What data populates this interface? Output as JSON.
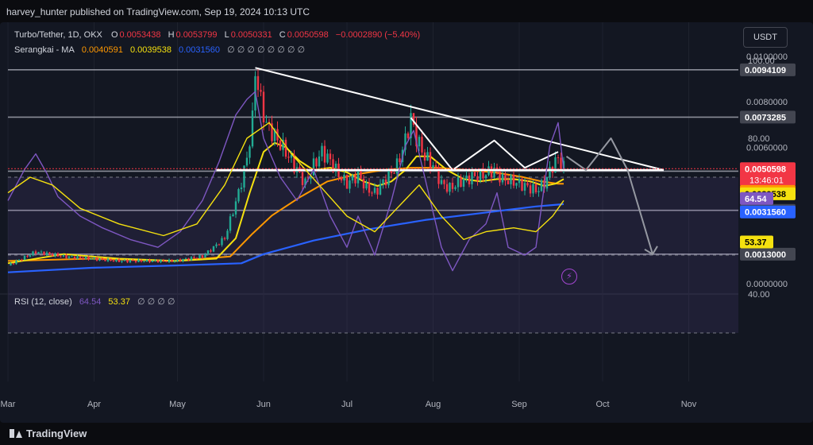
{
  "header": {
    "title": "harvey_hunter published on TradingView.com, Sep 19, 2024 10:13 UTC"
  },
  "footer": {
    "logo_text": "TradingView"
  },
  "toolbar": {
    "currency_label": "USDT"
  },
  "legend": {
    "symbol": "Turbo/Tether, 1D, OKX",
    "o_label": "O",
    "o_value": "0.0053438",
    "h_label": "H",
    "h_value": "0.0053799",
    "l_label": "L",
    "l_value": "0.0050331",
    "c_label": "C",
    "c_value": "0.0050598",
    "change": "−0.0002890 (−5.40%)",
    "ma_name": "Serangkai - MA",
    "ma_values": [
      "0.0040591",
      "0.0039538",
      "0.0031560"
    ],
    "ma_colors": [
      "#ff9800",
      "#f5e10f",
      "#2962ff"
    ],
    "ma_placeholders": "∅ ∅ ∅ ∅ ∅ ∅ ∅ ∅",
    "rsi_name": "RSI (12, close)",
    "rsi_values": [
      "64.54",
      "53.37"
    ],
    "rsi_placeholders": "∅ ∅ ∅ ∅"
  },
  "chart_data": {
    "type": "candlestick",
    "x_ticks": [
      "Mar",
      "Apr",
      "May",
      "Jun",
      "Jul",
      "Aug",
      "Sep",
      "Oct",
      "Nov"
    ],
    "x_tick_pos": [
      0,
      31,
      61,
      92,
      122,
      153,
      184,
      214,
      245
    ],
    "price_axis_labels": [
      "0.0100000",
      "0.0080000",
      "0.0060000",
      "0.0000000"
    ],
    "price_axis_values": [
      0.01,
      0.008,
      0.006,
      0.0
    ],
    "horizontal_levels": [
      {
        "value": 0.0094109,
        "label": "0.0094109",
        "color": "#b2b5be"
      },
      {
        "value": 0.0073285,
        "label": "0.0073285",
        "color": "#b2b5be"
      },
      {
        "value": 0.00495,
        "label": "0.0049500",
        "color": "#b2b5be"
      },
      {
        "value": 0.0032275,
        "label": "0.0032275",
        "color": "#b2b5be"
      },
      {
        "value": 0.0013,
        "label": "0.0013000",
        "color": "#b2b5be"
      }
    ],
    "badges": [
      {
        "value": 0.0050598,
        "label": "0.0050598",
        "sub": "13:46:01",
        "color": "#f23645"
      },
      {
        "value": 0.0040591,
        "label": "0.0040591",
        "color": "#ff9800"
      },
      {
        "value": 0.0039538,
        "label": "0.0039538",
        "color": "#f5e10f"
      },
      {
        "value": 0.003156,
        "label": "0.0031560",
        "color": "#2962ff"
      }
    ],
    "rsi_axis_labels": [
      "100.00",
      "80.00",
      "40.00"
    ],
    "rsi_axis_values": [
      100,
      80,
      40
    ],
    "rsi_badges": [
      {
        "value": 64.54,
        "label": "64.54",
        "color": "#7e57c2"
      },
      {
        "value": 53.37,
        "label": "53.37",
        "color": "#f5e10f"
      }
    ],
    "rsi_bands": [
      70,
      50,
      30
    ],
    "price_path": [
      [
        0,
        0.0008
      ],
      [
        10,
        0.0014
      ],
      [
        20,
        0.0012
      ],
      [
        30,
        0.0011
      ],
      [
        40,
        0.001
      ],
      [
        50,
        0.001
      ],
      [
        60,
        0.001
      ],
      [
        70,
        0.0012
      ],
      [
        78,
        0.002
      ],
      [
        83,
        0.004
      ],
      [
        86,
        0.0055
      ],
      [
        88,
        0.0072
      ],
      [
        89,
        0.0094
      ],
      [
        91,
        0.008
      ],
      [
        93,
        0.007
      ],
      [
        96,
        0.0065
      ],
      [
        100,
        0.0058
      ],
      [
        104,
        0.005
      ],
      [
        107,
        0.0044
      ],
      [
        110,
        0.0052
      ],
      [
        113,
        0.0058
      ],
      [
        116,
        0.0054
      ],
      [
        119,
        0.0048
      ],
      [
        122,
        0.0044
      ],
      [
        126,
        0.0048
      ],
      [
        129,
        0.0042
      ],
      [
        132,
        0.004
      ],
      [
        136,
        0.0046
      ],
      [
        140,
        0.0052
      ],
      [
        143,
        0.0063
      ],
      [
        145,
        0.0073
      ],
      [
        147,
        0.0064
      ],
      [
        150,
        0.0056
      ],
      [
        153,
        0.0052
      ],
      [
        156,
        0.0044
      ],
      [
        159,
        0.0042
      ],
      [
        163,
        0.0045
      ],
      [
        167,
        0.0047
      ],
      [
        171,
        0.0048
      ],
      [
        175,
        0.005
      ],
      [
        178,
        0.0046
      ],
      [
        182,
        0.0045
      ],
      [
        186,
        0.0043
      ],
      [
        190,
        0.0041
      ],
      [
        193,
        0.0044
      ],
      [
        196,
        0.0052
      ],
      [
        198,
        0.0055
      ],
      [
        200,
        0.0051
      ]
    ],
    "ma_fast": [
      [
        0,
        0.0009
      ],
      [
        20,
        0.0013
      ],
      [
        40,
        0.0011
      ],
      [
        60,
        0.001
      ],
      [
        75,
        0.0011
      ],
      [
        82,
        0.002
      ],
      [
        87,
        0.004
      ],
      [
        92,
        0.0058
      ],
      [
        96,
        0.0062
      ],
      [
        100,
        0.006
      ],
      [
        105,
        0.0054
      ],
      [
        110,
        0.005
      ],
      [
        116,
        0.0051
      ],
      [
        122,
        0.0049
      ],
      [
        128,
        0.0045
      ],
      [
        133,
        0.0043
      ],
      [
        138,
        0.0045
      ],
      [
        143,
        0.005
      ],
      [
        147,
        0.0056
      ],
      [
        152,
        0.0056
      ],
      [
        158,
        0.005
      ],
      [
        164,
        0.0046
      ],
      [
        170,
        0.0045
      ],
      [
        176,
        0.0046
      ],
      [
        182,
        0.0046
      ],
      [
        188,
        0.0045
      ],
      [
        193,
        0.0043
      ],
      [
        197,
        0.0044
      ],
      [
        200,
        0.0046
      ]
    ],
    "ma_mid": [
      [
        0,
        0.001
      ],
      [
        30,
        0.0011
      ],
      [
        60,
        0.001
      ],
      [
        80,
        0.0012
      ],
      [
        88,
        0.0022
      ],
      [
        95,
        0.003
      ],
      [
        105,
        0.0038
      ],
      [
        115,
        0.0045
      ],
      [
        125,
        0.0048
      ],
      [
        135,
        0.005
      ],
      [
        145,
        0.0051
      ],
      [
        155,
        0.0051
      ],
      [
        165,
        0.005
      ],
      [
        175,
        0.0049
      ],
      [
        185,
        0.0047
      ],
      [
        192,
        0.0045
      ],
      [
        198,
        0.0044
      ],
      [
        200,
        0.0044
      ]
    ],
    "ma_slow": [
      [
        0,
        0.0005
      ],
      [
        30,
        0.0007
      ],
      [
        60,
        0.0008
      ],
      [
        84,
        0.0009
      ],
      [
        92,
        0.0013
      ],
      [
        110,
        0.0019
      ],
      [
        130,
        0.0024
      ],
      [
        150,
        0.0028
      ],
      [
        170,
        0.0031
      ],
      [
        190,
        0.0034
      ],
      [
        200,
        0.0035
      ]
    ],
    "rsi_main": [
      [
        0,
        64
      ],
      [
        6,
        72
      ],
      [
        10,
        76
      ],
      [
        14,
        71
      ],
      [
        18,
        65
      ],
      [
        26,
        60
      ],
      [
        34,
        57
      ],
      [
        44,
        54
      ],
      [
        54,
        52
      ],
      [
        62,
        56
      ],
      [
        70,
        64
      ],
      [
        76,
        74
      ],
      [
        82,
        86
      ],
      [
        86,
        90
      ],
      [
        89,
        92
      ],
      [
        92,
        80
      ],
      [
        98,
        70
      ],
      [
        104,
        64
      ],
      [
        110,
        72
      ],
      [
        116,
        60
      ],
      [
        122,
        52
      ],
      [
        126,
        60
      ],
      [
        132,
        50
      ],
      [
        138,
        64
      ],
      [
        143,
        78
      ],
      [
        146,
        82
      ],
      [
        150,
        70
      ],
      [
        156,
        52
      ],
      [
        160,
        46
      ],
      [
        166,
        54
      ],
      [
        172,
        58
      ],
      [
        176,
        66
      ],
      [
        180,
        52
      ],
      [
        186,
        50
      ],
      [
        190,
        52
      ],
      [
        195,
        78
      ],
      [
        198,
        84
      ],
      [
        200,
        72
      ]
    ],
    "rsi_signal": [
      [
        0,
        66
      ],
      [
        8,
        70
      ],
      [
        16,
        68
      ],
      [
        26,
        62
      ],
      [
        40,
        58
      ],
      [
        56,
        55
      ],
      [
        68,
        58
      ],
      [
        78,
        68
      ],
      [
        86,
        80
      ],
      [
        94,
        84
      ],
      [
        102,
        76
      ],
      [
        112,
        68
      ],
      [
        122,
        60
      ],
      [
        132,
        56
      ],
      [
        140,
        62
      ],
      [
        148,
        68
      ],
      [
        156,
        60
      ],
      [
        164,
        54
      ],
      [
        172,
        56
      ],
      [
        182,
        57
      ],
      [
        190,
        56
      ],
      [
        196,
        60
      ],
      [
        200,
        64
      ]
    ],
    "drawings": {
      "trendline_top": [
        [
          89,
          0.0095
        ],
        [
          236,
          0.005
        ]
      ],
      "support": [
        [
          75,
          0.005
        ],
        [
          236,
          0.005
        ]
      ],
      "wave": [
        [
          145,
          0.0073
        ],
        [
          160,
          0.005
        ],
        [
          175,
          0.0063
        ],
        [
          186,
          0.0051
        ],
        [
          198,
          0.0058
        ]
      ],
      "projection": [
        [
          201,
          0.0056
        ],
        [
          208,
          0.005
        ],
        [
          217,
          0.0064
        ],
        [
          223,
          0.005
        ],
        [
          232,
          0.0013
        ]
      ]
    }
  }
}
